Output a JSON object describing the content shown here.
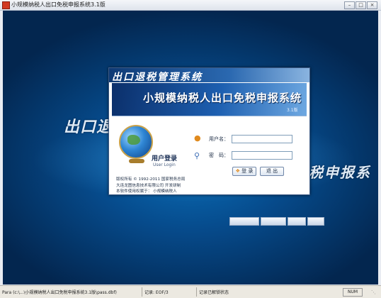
{
  "window": {
    "title": "小规模纳税人出口免税申报系统3.1版",
    "min": "–",
    "max": "□",
    "close": "×"
  },
  "background": {
    "left_text": "出口退",
    "right_text": "税申报系",
    "buttons": [
      "",
      "",
      "",
      ""
    ]
  },
  "dialog": {
    "title": "出口退税管理系统",
    "banner_name": "小规模纳税人出口免税申报系统",
    "banner_version": "3.1版",
    "login_cn": "用户登录",
    "login_en": "User Login",
    "username_label": "用户名：",
    "username_value": "",
    "password_label": "密　码：",
    "password_value": "",
    "login_button": "登 录",
    "exit_button": "退 出",
    "copyright": [
      "版权所有 © 1992-2011 国家税务总局",
      "大连龙图信息技术有限公司 开发研制",
      "本软件使用权属于： 小规模纳税人"
    ]
  },
  "statusbar": {
    "path": "Para (c:\\...\\小规模纳税人出口免税申报系统3.1版\\pass.dbf)",
    "record": "记录: EOF/3",
    "lock": "记录已解锁状态",
    "mode": "NUM"
  },
  "colors": {
    "desktop_blue": "#064b8c",
    "dialog_header": "#0f3a74",
    "accent_orange": "#e08a1e"
  },
  "icons": {
    "app": "app-icon",
    "user": "user-icon",
    "password": "key-icon",
    "globe": "globe-icon"
  }
}
